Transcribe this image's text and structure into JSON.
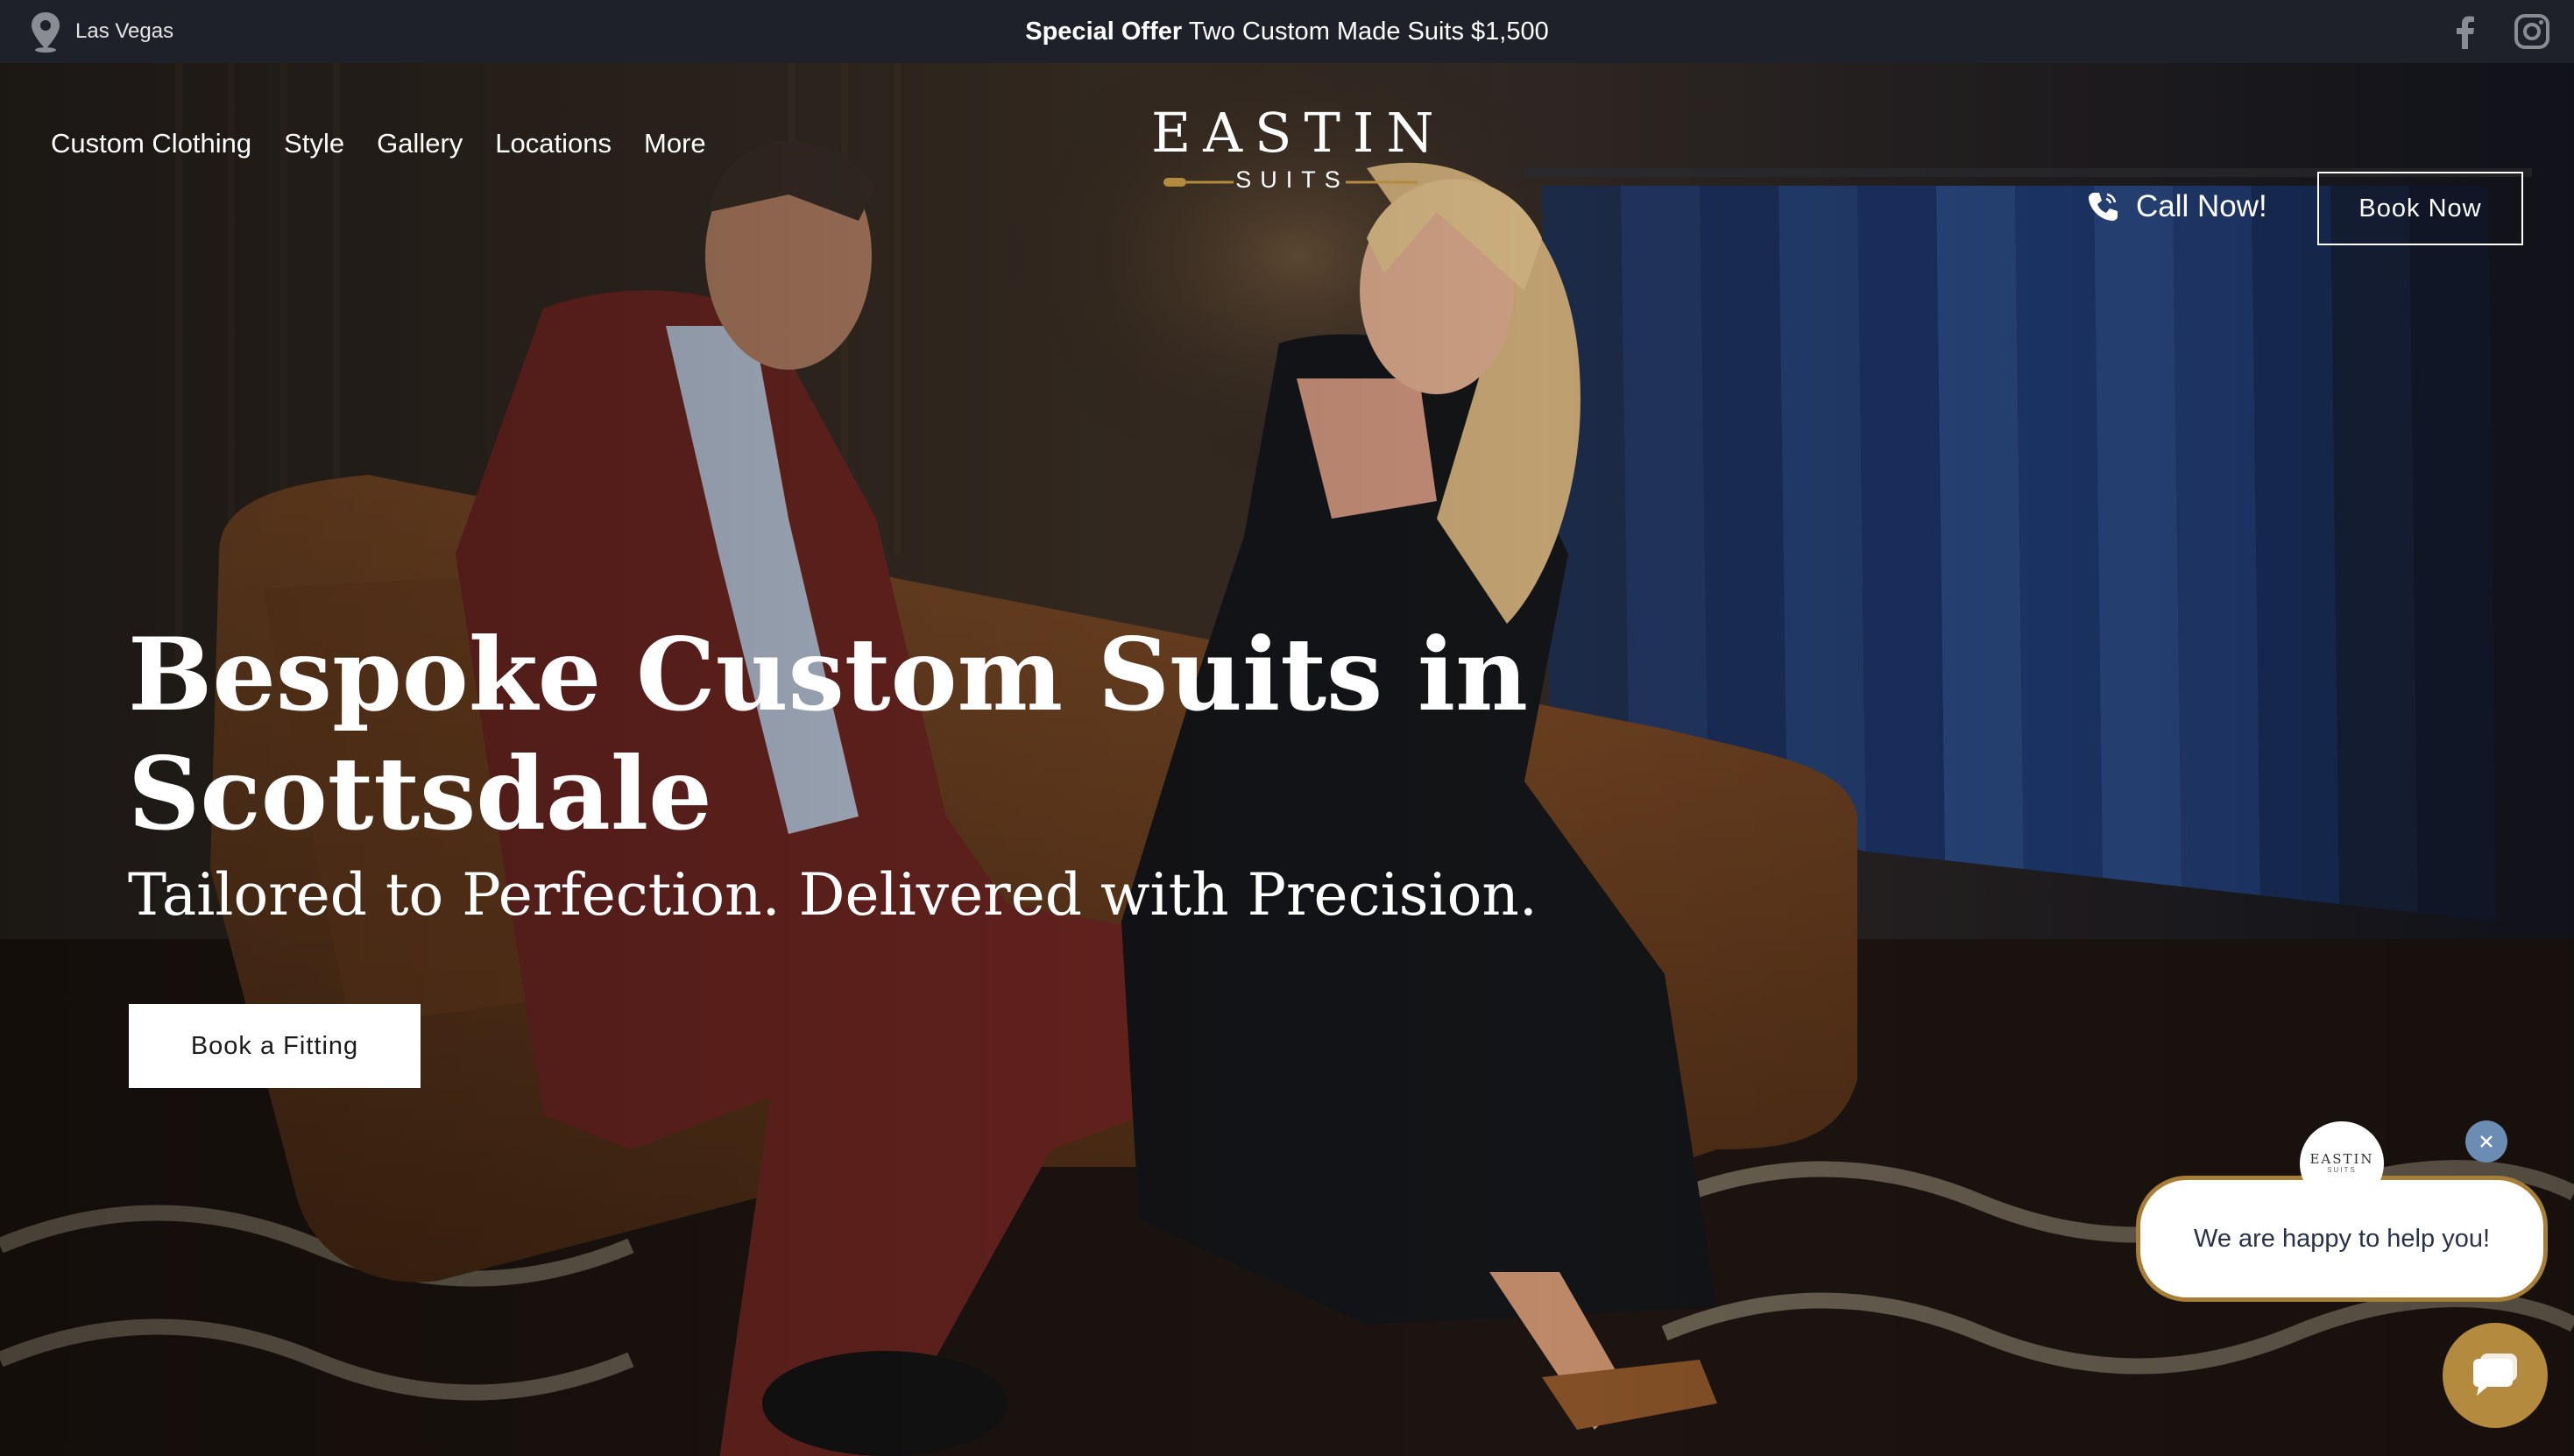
{
  "topbar": {
    "location": "Las Vegas",
    "offer_bold": "Special Offer",
    "offer_text": " Two Custom Made Suits $1,500",
    "social": [
      "facebook-icon",
      "instagram-icon"
    ]
  },
  "nav": {
    "items": [
      {
        "label": "Custom Clothing"
      },
      {
        "label": "Style"
      },
      {
        "label": "Gallery"
      },
      {
        "label": "Locations"
      },
      {
        "label": "More"
      }
    ],
    "call_label": "Call Now!",
    "book_label": "Book Now"
  },
  "logo": {
    "main": "EASTIN",
    "sub": "SUITS"
  },
  "hero": {
    "headline": "Bespoke Custom Suits in Scottsdale",
    "subheadline": "Tailored to Perfection. Delivered with Precision.",
    "cta_label": "Book a Fitting"
  },
  "chat": {
    "avatar_text": "EASTIN",
    "avatar_sub": "SUITS",
    "message": "We are happy to help you!",
    "accent": "#b48a3e",
    "close_color": "#6b8cb3"
  },
  "colors": {
    "topbar_bg": "#1f212a",
    "text": "#ffffff",
    "chat_border": "#a67e36"
  }
}
